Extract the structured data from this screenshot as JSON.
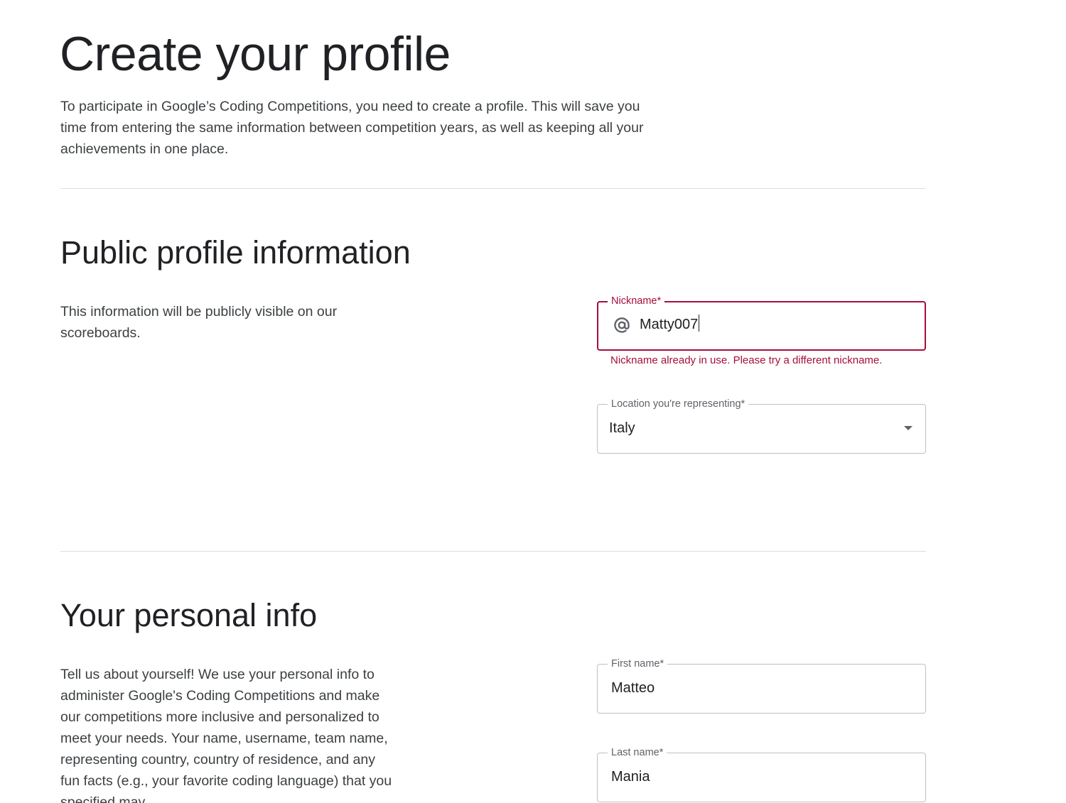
{
  "header": {
    "title": "Create your profile",
    "intro": "To participate in Google’s Coding Competitions, you need to create a profile. This will save you time from entering the same information between competition years, as well as keeping all your achievements in one place."
  },
  "public_profile": {
    "title": "Public profile information",
    "description": "This information will be publicly visible on our scoreboards.",
    "nickname": {
      "label": "Nickname*",
      "value": "Matty007",
      "error": "Nickname already in use. Please try a different nickname."
    },
    "location": {
      "label": "Location you're representing*",
      "value": "Italy"
    }
  },
  "personal_info": {
    "title": "Your personal info",
    "description": "Tell us about yourself! We use your personal info to administer Google's Coding Competitions and make our competitions more inclusive and personalized to meet your needs. Your name, username, team name, representing country, country of residence, and any fun facts (e.g., your favorite coding language) that you specified may",
    "first_name": {
      "label": "First name*",
      "value": "Matteo"
    },
    "last_name": {
      "label": "Last name*",
      "value": "Mania"
    }
  },
  "colors": {
    "error": "#a50e3a",
    "text_primary": "#202124",
    "text_secondary": "#3c4043",
    "border": "#bdc1c6",
    "divider": "#dadce0"
  },
  "icons": {
    "nickname_prefix": "at-sign-icon",
    "location_dropdown": "arrow-drop-down-icon"
  }
}
